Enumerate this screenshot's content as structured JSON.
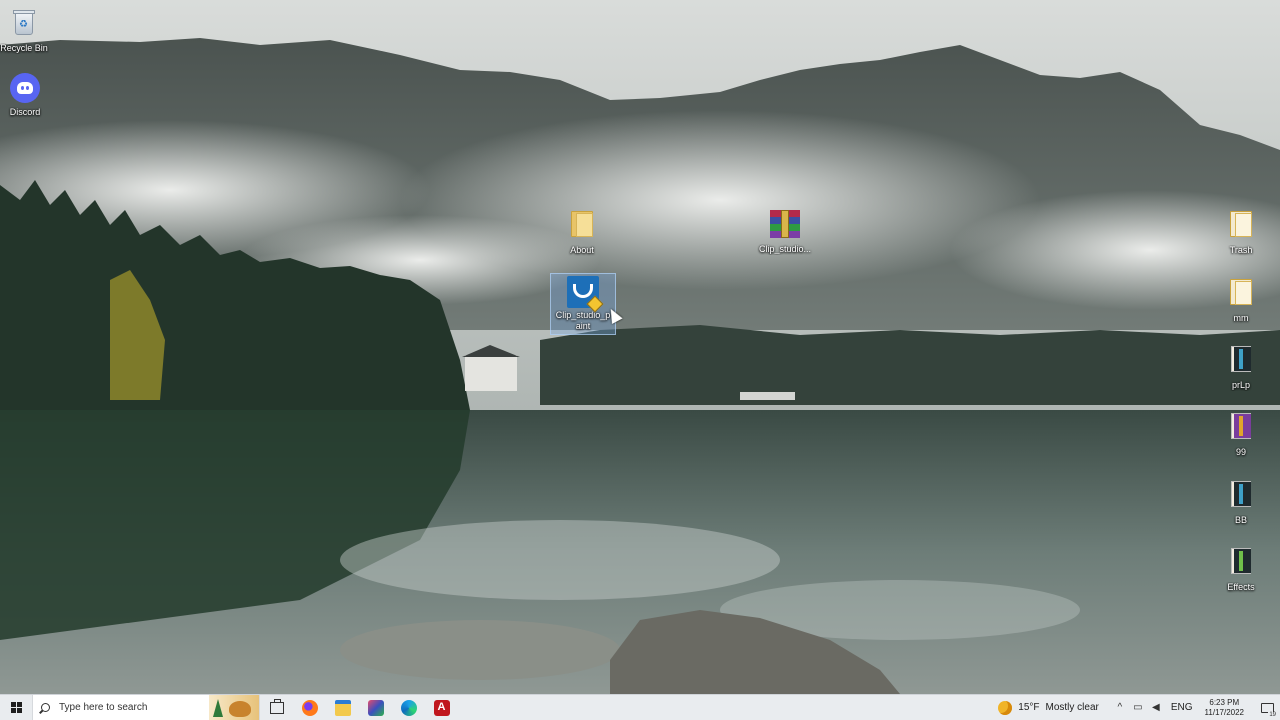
{
  "desktop": {
    "icons": [
      {
        "label": "Recycle Bin",
        "icon": "recycle-bin-icon"
      },
      {
        "label": "Discord",
        "icon": "discord-icon"
      },
      {
        "label": "About",
        "icon": "folder-icon"
      },
      {
        "label": "Clip_studio...",
        "icon": "winrar-archive-icon"
      },
      {
        "label": "Clip_studio_p aint",
        "icon": "clip-studio-paint-icon"
      },
      {
        "label": "Trash",
        "icon": "folder-icon"
      },
      {
        "label": "mm",
        "icon": "folder-icon"
      },
      {
        "label": "prLp",
        "icon": "archive-book-icon"
      },
      {
        "label": "99",
        "icon": "archive-book-icon"
      },
      {
        "label": "BB",
        "icon": "archive-book-icon"
      },
      {
        "label": "Effects",
        "icon": "archive-book-icon"
      }
    ]
  },
  "taskbar": {
    "search_placeholder": "Type here to search",
    "apps": [
      "task-view-icon",
      "firefox-icon",
      "file-explorer-icon",
      "clip-studio-icon",
      "edge-icon",
      "acrobat-icon"
    ],
    "weather": {
      "temp": "15°F",
      "condition": "Mostly clear"
    },
    "language": "ENG",
    "time": "6:23 PM",
    "date": "11/17/2022",
    "notification_count": "19"
  },
  "colors": {
    "taskbar_bg": "#e9ecef",
    "discord": "#5865f2",
    "clip_studio": "#1d6fb8"
  }
}
